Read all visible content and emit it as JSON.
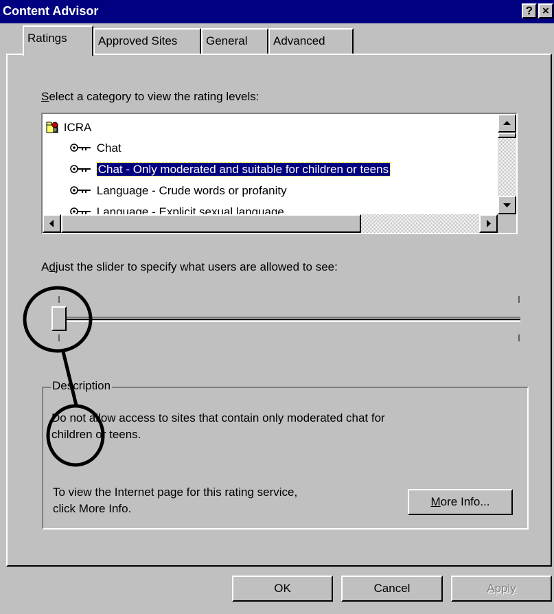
{
  "window": {
    "title": "Content Advisor",
    "help_button": "?",
    "close_button": "×"
  },
  "tabs": [
    {
      "label": "Ratings",
      "active": true
    },
    {
      "label": "Approved Sites",
      "active": false
    },
    {
      "label": "General",
      "active": false
    },
    {
      "label": "Advanced",
      "active": false
    }
  ],
  "ratings": {
    "category_prompt_first": "S",
    "category_prompt_rest": "elect a category to view the rating levels:",
    "list_items": [
      {
        "label": "ICRA",
        "icon": "ratings-folder-icon",
        "indent": 0,
        "selected": false
      },
      {
        "label": "Chat",
        "icon": "key-icon",
        "indent": 1,
        "selected": false
      },
      {
        "label": "Chat - Only moderated and suitable for children or teens",
        "icon": "key-icon",
        "indent": 1,
        "selected": true
      },
      {
        "label": "Language - Crude words or profanity",
        "icon": "key-icon",
        "indent": 1,
        "selected": false
      },
      {
        "label": "Language - Explicit sexual language",
        "icon": "key-icon",
        "indent": 1,
        "selected": false
      }
    ],
    "slider_prompt_pre": "A",
    "slider_prompt_u": "d",
    "slider_prompt_rest": "just the slider to specify what users are allowed to see:",
    "slider_level": 0,
    "description_group_label": "Description",
    "description_text_line1": "Do not allow access to sites that contain only moderated chat for",
    "description_text_line2": "children or teens.",
    "info_text_line1": "To view the Internet page for this rating service,",
    "info_text_line2": "click More Info.",
    "more_info_u": "M",
    "more_info_rest": "ore Info..."
  },
  "buttons": {
    "ok": "OK",
    "cancel": "Cancel",
    "apply": "Apply"
  },
  "colors": {
    "titlebar": "#000080",
    "face": "#c0c0c0",
    "selection": "#000080",
    "annotation_circle": "#000000"
  }
}
